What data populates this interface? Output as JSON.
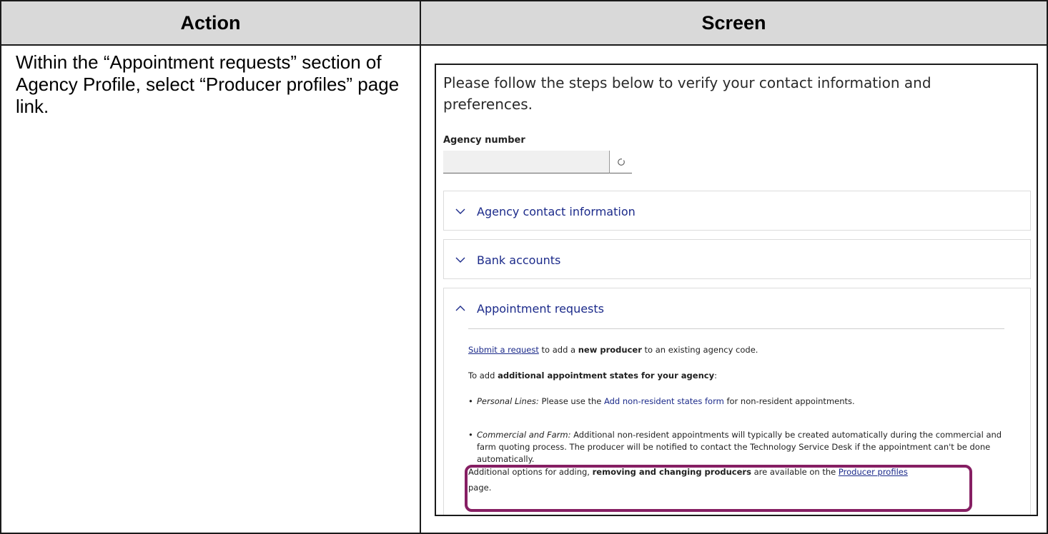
{
  "table": {
    "header_action": "Action",
    "header_screen": "Screen",
    "action_text": "Within the “Appointment requests” section of Agency Profile, select “Producer profiles” page link."
  },
  "screen": {
    "intro": "Please follow the steps below to verify your contact information and preferences.",
    "agency_number_label": "Agency number",
    "agency_number_value": "",
    "agency_button_icon": "refresh-icon",
    "accordions": [
      {
        "title": "Agency contact information",
        "state": "collapsed"
      },
      {
        "title": "Bank accounts",
        "state": "collapsed"
      },
      {
        "title": "Appointment requests",
        "state": "expanded"
      }
    ],
    "appointment": {
      "submit_link": "Submit a request",
      "submit_text_1": " to add a ",
      "submit_bold": "new producer",
      "submit_text_2": " to an existing agency code.",
      "add_text": "To add ",
      "add_bold": "additional appointment states for your agency",
      "add_colon": ":",
      "personal_italic": "Personal Lines:",
      "personal_text_1": " Please use the ",
      "personal_link": "Add non-resident states form",
      "personal_text_2": " for non-resident appointments.",
      "commercial_italic": "Commercial and Farm:",
      "commercial_text": " Additional non-resident appointments will typically be created automatically during the commercial and farm quoting process. The producer will be notified to contact the Technology Service Desk if the appointment can't be done automatically.",
      "options_text_1": "Additional options for adding, ",
      "options_bold": "removing and changing producers",
      "options_text_2": " are available on the ",
      "options_link": "Producer profiles",
      "options_text_3": " page."
    },
    "highlight_color": "#861f63",
    "link_color": "#1b2a8a"
  }
}
